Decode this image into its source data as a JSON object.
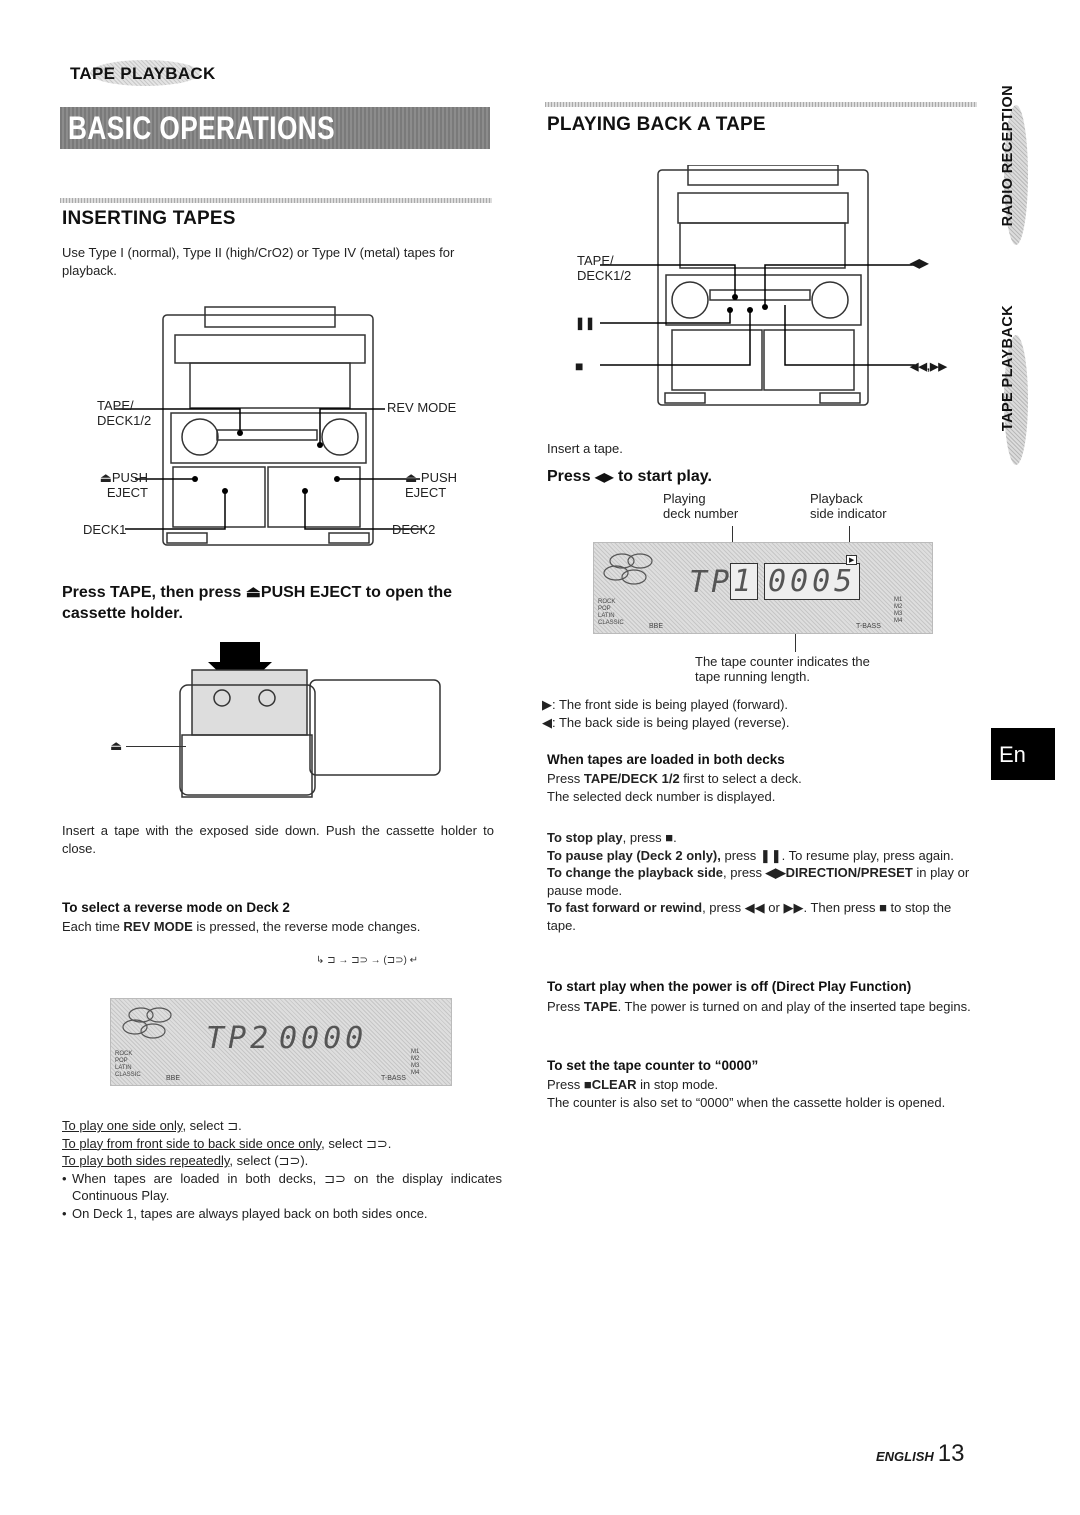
{
  "header": {
    "section_tag": "TAPE PLAYBACK",
    "banner": "BASIC OPERATIONS"
  },
  "inserting": {
    "title": "INSERTING TAPES",
    "intro": "Use Type I (normal), Type II (high/CrO2) or Type IV (metal) tapes for playback.",
    "diagram_labels": {
      "tape_deck": [
        "TAPE/",
        "DECK1/2"
      ],
      "rev_mode": "REV MODE",
      "push_eject_left": [
        "PUSH",
        "EJECT"
      ],
      "push_eject_right": [
        "PUSH",
        "EJECT"
      ],
      "deck1": "DECK1",
      "deck2": "DECK2",
      "eject_symbol": "⏏"
    },
    "step1": "Press TAPE, then press ⏏PUSH EJECT to open the cassette holder.",
    "step2": "Insert a tape with the exposed side down. Push the cassette holder to close.",
    "reverse": {
      "title": "To select a reverse mode on Deck 2",
      "text_pre": "Each time ",
      "text_bold": "REV MODE",
      "text_post": " is pressed, the reverse mode changes.",
      "cycle": "↳ ⊐ → ⊐⊃ → (⊐⊃) ↵",
      "lcd": {
        "deck": "TP2",
        "counter": "0000",
        "eq": [
          "ROCK",
          "POP",
          "LATIN",
          "CLASSIC"
        ],
        "left_label": "BBE",
        "right_label": "T-BASS",
        "memory": [
          "M1",
          "M2",
          "M3",
          "M4"
        ]
      },
      "options": [
        {
          "underlined": "To play one side only",
          "rest": ", select ⊐."
        },
        {
          "underlined": "To play from front side to back side once only",
          "rest": ", select ⊐⊃."
        },
        {
          "underlined": "To play both sides repeatedly",
          "rest": ", select (⊐⊃)."
        }
      ],
      "notes": [
        "When tapes are loaded in both decks, ⊐⊃ on the display indicates Continuous Play.",
        "On Deck 1, tapes are always played back on both sides once."
      ]
    }
  },
  "playing": {
    "title": "PLAYING BACK A TAPE",
    "diagram_labels": {
      "tape_deck": [
        "TAPE/",
        "DECK1/2"
      ],
      "pause": "❚❚",
      "stop": "■",
      "play": "◀▶",
      "ff_rew": "◀◀,▶▶"
    },
    "step1": "Insert a tape.",
    "step2_pre": "Press ",
    "step2_icon": "◀▶",
    "step2_post": " to start play.",
    "callouts": {
      "deck_number": [
        "Playing",
        "deck number"
      ],
      "side_indicator": [
        "Playback",
        "side indicator"
      ],
      "counter": [
        "The tape counter indicates the",
        "tape running length."
      ]
    },
    "lcd": {
      "deck_prefix": "TP",
      "deck": "1",
      "counter": "0005",
      "eq": [
        "ROCK",
        "POP",
        "LATIN",
        "CLASSIC"
      ],
      "left_label": "BBE",
      "right_label": "T-BASS",
      "memory": [
        "M1",
        "M2",
        "M3",
        "M4"
      ]
    },
    "direction_notes": [
      {
        "icon": "▶",
        "text": ": The front side is being played (forward)."
      },
      {
        "icon": "◀",
        "text": ": The back side is being played (reverse)."
      }
    ],
    "both_decks": {
      "title": "When tapes are loaded in both decks",
      "line1_pre": "Press ",
      "line1_bold": "TAPE/DECK 1/2",
      "line1_post": " first to select a deck.",
      "line2": "The selected deck number is displayed."
    },
    "controls": [
      {
        "bold": "To stop play",
        "rest": ", press ■."
      },
      {
        "bold": "To pause play (Deck 2 only),",
        "rest": " press ❚❚. To resume play, press again."
      },
      {
        "bold": "To change the playback side",
        "rest": ", press ",
        "bold2": "◀▶DIRECTION/PRESET",
        "rest2": " in play or pause mode."
      },
      {
        "bold": "To fast forward or rewind",
        "rest": ", press ◀◀ or ▶▶. Then press ■ to stop the tape."
      }
    ],
    "direct_play": {
      "title": "To start play when the power is off (Direct Play Function)",
      "pre": "Press ",
      "bold": "TAPE",
      "post": ". The power is turned on and play of the inserted tape begins."
    },
    "counter_reset": {
      "title": "To set the tape counter to “0000”",
      "line1_pre": "Press ",
      "line1_bold": "■CLEAR",
      "line1_post": " in stop mode.",
      "line2": "The counter is also set to “0000” when the cassette holder is opened."
    }
  },
  "side_tabs": [
    "RADIO RECEPTION",
    "TAPE PLAYBACK"
  ],
  "language_tab": "En",
  "footer": {
    "language": "ENGLISH",
    "page": "13"
  }
}
